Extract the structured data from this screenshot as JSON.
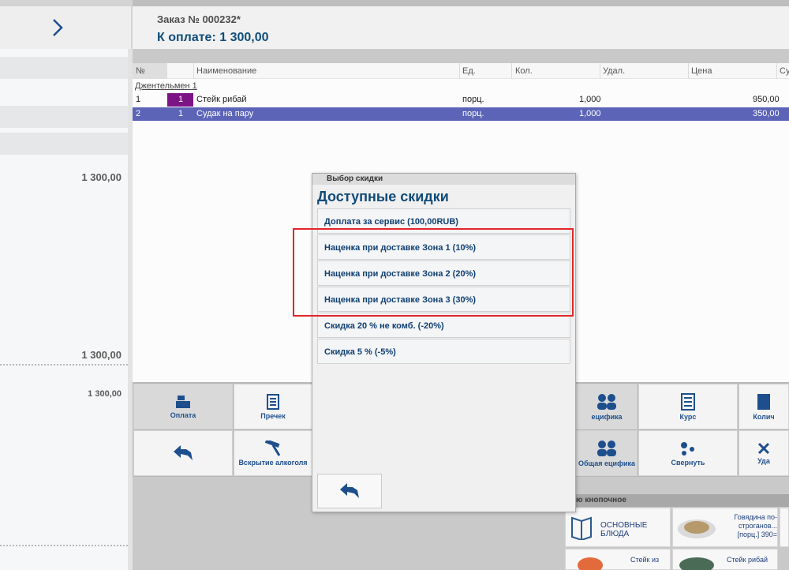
{
  "header": {
    "order": "Заказ № 000232*",
    "to_pay": "К оплате: 1 300,00"
  },
  "left": {
    "amount_1": "1 300,00",
    "amount_2": "1 300,00",
    "amount_3": "1 300,00"
  },
  "table": {
    "columns": [
      "№",
      "Наименование",
      "Ед.",
      "Кол.",
      "Удал.",
      "Цена",
      "Су"
    ],
    "group": "Джентельмен 1",
    "rows": [
      {
        "num": "1",
        "count": "1",
        "name": "Стейк рибай",
        "unit": "порц.",
        "qty": "1,000",
        "price": "950,00"
      },
      {
        "num": "2",
        "count": "1",
        "name": "Судак на пару",
        "unit": "порц.",
        "qty": "1,000",
        "price": "350,00"
      }
    ]
  },
  "buttons": {
    "payment": "Оплата",
    "precheck": "Пречек",
    "spec": "ецифика",
    "rate": "Курс",
    "qty": "Колич",
    "open_alcohol": "Вскрытие алкоголя",
    "common_spec": "Общая ецифика",
    "collapse": "Свернуть",
    "delete": "Уда"
  },
  "menu": {
    "title": "ю кнопочное",
    "main_dishes": "ОСНОВНЫЕ БЛЮДА",
    "beef": "Говядина по-строганов... [порц.] 390=",
    "steak_from": "Стейк из",
    "steak_ribai": "Стейк рибай"
  },
  "dialog": {
    "bar": "Выбор скидки",
    "title": "Доступные скидки",
    "options": [
      "Доплата за сервис (100,00RUB)",
      "Наценка при доставке Зона 1 (10%)",
      "Наценка при доставке Зона 2 (20%)",
      "Наценка при доставке Зона 3 (30%)",
      "Скидка 20 % не комб. (-20%)",
      "Скидка 5 % (-5%)"
    ]
  },
  "colors": {
    "accent": "#104b78",
    "selection": "#5c64b8",
    "highlight": "#e2262b",
    "count_box": "#7d1486"
  }
}
